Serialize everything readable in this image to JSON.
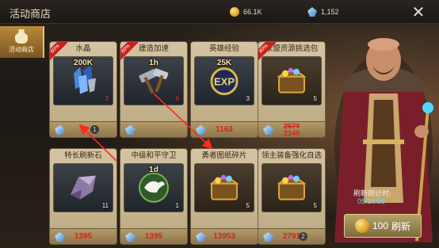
{
  "header": {
    "title": "活动商店",
    "gold": "66.1K",
    "gems": "1,152"
  },
  "sidebar": {
    "tab_label": "活动商店"
  },
  "items": [
    {
      "name": "水晶",
      "label": "200K",
      "qty": "3",
      "qty_red": true,
      "discount": "80%",
      "price": "1",
      "old_price": "",
      "new_price": "",
      "info": "1",
      "icon": "crystal-icon"
    },
    {
      "name": "建造加速",
      "label": "1h",
      "qty": "6",
      "qty_red": true,
      "discount": "80%",
      "price": "",
      "old_price": "",
      "new_price": "",
      "info": "",
      "icon": "hammer-icon"
    },
    {
      "name": "英雄经验",
      "label": "25K",
      "qty": "3",
      "qty_red": false,
      "discount": "",
      "price": "1163",
      "old_price": "",
      "new_price": "",
      "info": "",
      "icon": "exp-icon"
    },
    {
      "name": "联盟资源挑选包",
      "label": "",
      "qty": "5",
      "qty_red": false,
      "discount": "80%",
      "price": "",
      "old_price": "2674",
      "new_price": "2140",
      "info": "",
      "icon": "chest-icon"
    },
    {
      "name": "特长刷新石",
      "label": "",
      "qty": "11",
      "qty_red": false,
      "discount": "",
      "price": "1395",
      "old_price": "",
      "new_price": "",
      "info": "",
      "icon": "stone-icon"
    },
    {
      "name": "中级和平守卫",
      "label": "1d",
      "qty": "1",
      "qty_red": false,
      "discount": "",
      "price": "1395",
      "old_price": "",
      "new_price": "",
      "info": "",
      "icon": "dove-icon"
    },
    {
      "name": "勇者图纸碎片",
      "label": "",
      "qty": "5",
      "qty_red": false,
      "discount": "",
      "price": "13953",
      "old_price": "",
      "new_price": "",
      "info": "",
      "icon": "chest-icon"
    },
    {
      "name": "领主装备强化自选包",
      "label": "",
      "qty": "5",
      "qty_red": false,
      "discount": "",
      "price": "2791",
      "old_price": "",
      "new_price": "",
      "info": "2",
      "icon": "chest-icon"
    }
  ],
  "countdown": {
    "label": "刷新倒计时:",
    "time": "05:16:55"
  },
  "refresh_button": {
    "cost": "100",
    "label": "刷新"
  },
  "colors": {
    "price_red": "#d2241a",
    "countdown_cyan": "#5fe0ff",
    "card_bg": "#d4c4a3"
  }
}
